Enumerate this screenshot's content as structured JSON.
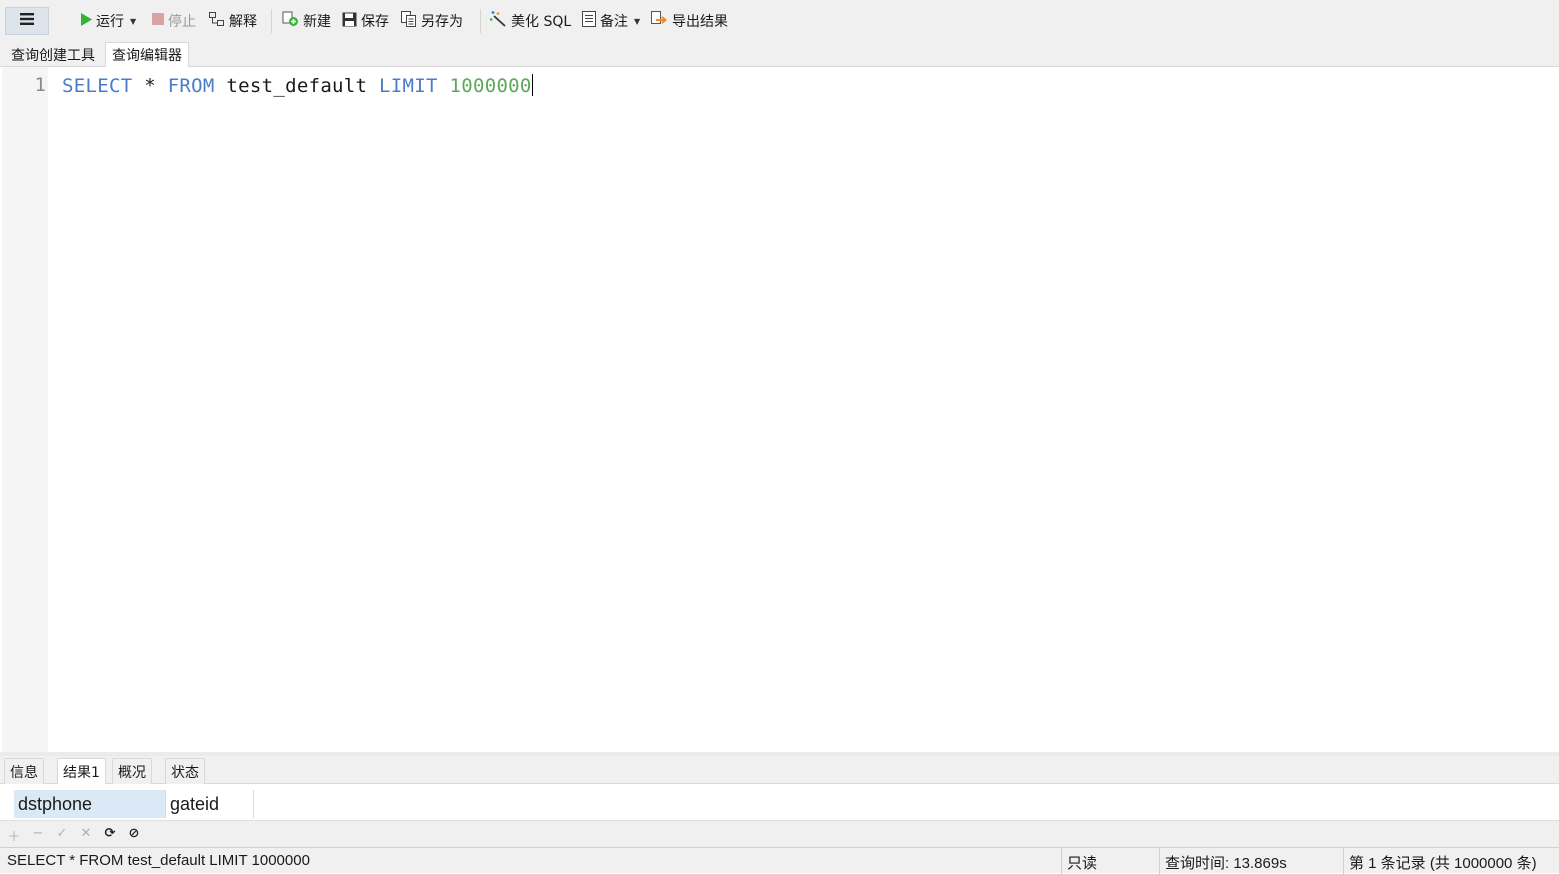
{
  "toolbar": {
    "run": "运行",
    "stop": "停止",
    "explain": "解释",
    "new": "新建",
    "save": "保存",
    "save_as": "另存为",
    "beautify": "美化 SQL",
    "notes": "备注",
    "export": "导出结果"
  },
  "tabs": [
    "查询创建工具",
    "查询编辑器"
  ],
  "editor": {
    "line_number": "1",
    "kw_select": "SELECT",
    "star": "*",
    "kw_from": "FROM",
    "table": "test_default",
    "kw_limit": "LIMIT",
    "limit_value": "1000000"
  },
  "result_tabs": [
    "信息",
    "结果1",
    "概况",
    "状态"
  ],
  "grid": {
    "columns": [
      "dstphone",
      "gateid"
    ]
  },
  "status": {
    "query": "SELECT * FROM test_default LIMIT 1000000",
    "mode": "只读",
    "time": "查询时间: 13.869s",
    "records": "第 1 条记录 (共 1000000 条)"
  },
  "colors": {
    "keyword": "#4a7cc9",
    "number": "#5fa85a",
    "run_icon": "#2fb52f",
    "stop_icon": "#d9a3a3",
    "export_icon": "#f08a24"
  },
  "icons": [
    "menu-icon",
    "play-icon",
    "stop-icon",
    "explain-icon",
    "new-icon",
    "save-icon",
    "save-as-icon",
    "magic-wand-icon",
    "note-icon",
    "export-icon",
    "add-icon",
    "remove-icon",
    "apply-icon",
    "discard-icon",
    "refresh-icon",
    "cancel-icon"
  ]
}
